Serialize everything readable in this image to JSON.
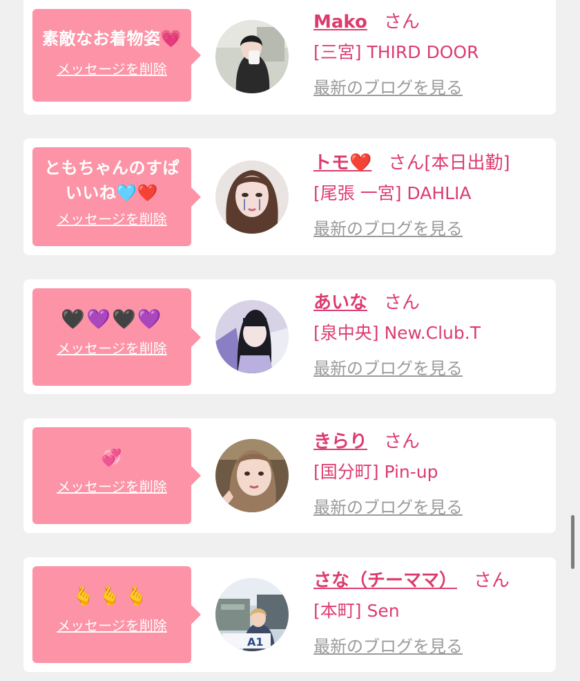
{
  "delete_label": "メッセージを削除",
  "blog_label": "最新のブログを見る",
  "san_label": "さん",
  "colors": {
    "background": "#f0f0f0",
    "card": "#ffffff",
    "bubble": "#fc93a6",
    "accent": "#dc3b6e",
    "link_gray": "#9a9a9a"
  },
  "messages": [
    {
      "message_text": "素敵なお着物姿",
      "message_emoji": "💗",
      "name": "Mako",
      "status": "",
      "shop": "[三宮] THIRD DOOR",
      "avatar_icon": "avatar-photo"
    },
    {
      "message_text": "ともちゃんのすぱいいね",
      "message_emoji": "🩵❤️",
      "name": "トモ",
      "name_emoji": "❤️",
      "status": "[本日出勤]",
      "shop": "[尾張 一宮] DAHLIA",
      "avatar_icon": "avatar-photo"
    },
    {
      "message_text": "",
      "message_emoji": "🖤💜🖤💜",
      "name": "あいな",
      "status": "",
      "shop": "[泉中央] New.Club.T",
      "avatar_icon": "avatar-photo"
    },
    {
      "message_text": "",
      "message_emoji": "💞",
      "name": "きらり",
      "status": "",
      "shop": "[国分町] Pin-up",
      "avatar_icon": "avatar-photo"
    },
    {
      "message_text": "",
      "message_emoji": "🫰🫰🫰",
      "name": "さな（チーママ）",
      "status": "",
      "shop": "[本町] Sen",
      "avatar_icon": "avatar-photo"
    }
  ]
}
